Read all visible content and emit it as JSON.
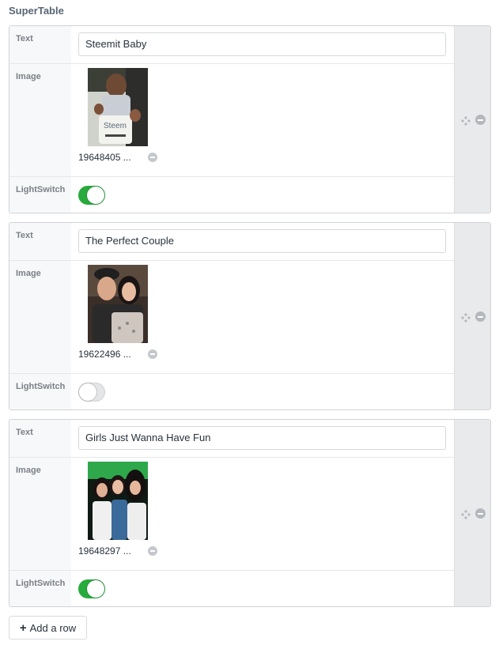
{
  "field_label": "SuperTable",
  "rows": [
    {
      "text_label": "Text",
      "text_value": "Steemit Baby",
      "image_label": "Image",
      "image_file": "19648405 ...",
      "switch_label": "LightSwitch",
      "switch_on": true
    },
    {
      "text_label": "Text",
      "text_value": "The Perfect Couple",
      "image_label": "Image",
      "image_file": "19622496 ...",
      "switch_label": "LightSwitch",
      "switch_on": false
    },
    {
      "text_label": "Text",
      "text_value": "Girls Just Wanna Have Fun",
      "image_label": "Image",
      "image_file": "19648297 ...",
      "switch_label": "LightSwitch",
      "switch_on": true
    }
  ],
  "add_row_label": "Add a row",
  "colors": {
    "switch_on": "#27ab3c",
    "switch_off": "#e4e6e8",
    "label": "#7b8087",
    "heading": "#576575"
  },
  "icons": {
    "move": "move-icon",
    "delete": "delete-icon",
    "remove_asset": "remove-icon",
    "add": "plus-icon"
  }
}
